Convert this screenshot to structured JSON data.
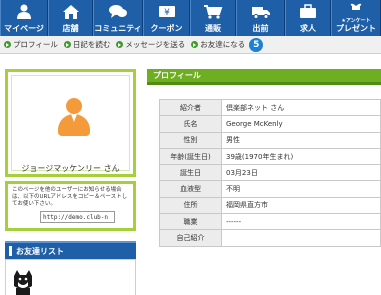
{
  "nav": {
    "items": [
      {
        "label": "マイページ",
        "icon": "person-icon"
      },
      {
        "label": "店舗",
        "icon": "home-icon"
      },
      {
        "label": "コミュニティ",
        "icon": "chat-icon"
      },
      {
        "label": "クーポン",
        "icon": "coupon-icon"
      },
      {
        "label": "通販",
        "icon": "cart-icon"
      },
      {
        "label": "出前",
        "icon": "truck-icon"
      },
      {
        "label": "求人",
        "icon": "briefcase-icon"
      },
      {
        "label": "プレゼント",
        "sublabel": "★アンケート",
        "icon": "gift-icon"
      }
    ]
  },
  "subnav": {
    "links": [
      "プロフィール",
      "日記を読む",
      "メッセージを送る",
      "お友達になる"
    ],
    "step_badge": "5"
  },
  "profile_card": {
    "name": "ジョージマッケンリー さん"
  },
  "url_box": {
    "note": "このページを他のユーザーにお知らせる場合は、以下のURLアドレスをコピー＆ペーストしてお使い下さい。",
    "url": "http://demo.club-n"
  },
  "friends": {
    "title": "お友達リスト"
  },
  "profile": {
    "title": "プロフィール",
    "rows": [
      {
        "key": "紹介者",
        "value": "倶楽部ネット さん"
      },
      {
        "key": "氏名",
        "value": "George McKenly"
      },
      {
        "key": "性別",
        "value": "男性"
      },
      {
        "key": "年齢(誕生日)",
        "value": "39歳(1970年生まれ)"
      },
      {
        "key": "誕生日",
        "value": "03月23日"
      },
      {
        "key": "血液型",
        "value": "不明"
      },
      {
        "key": "住所",
        "value": "福岡県直方市"
      },
      {
        "key": "職業",
        "value": "------"
      },
      {
        "key": "自己紹介",
        "value": ""
      }
    ]
  },
  "colors": {
    "nav_blue": "#1f5fa7",
    "accent_green": "#6fae22",
    "frame_green": "#a6cf3c",
    "avatar_orange": "#f49a3a",
    "badge_blue": "#1e7fd3"
  }
}
